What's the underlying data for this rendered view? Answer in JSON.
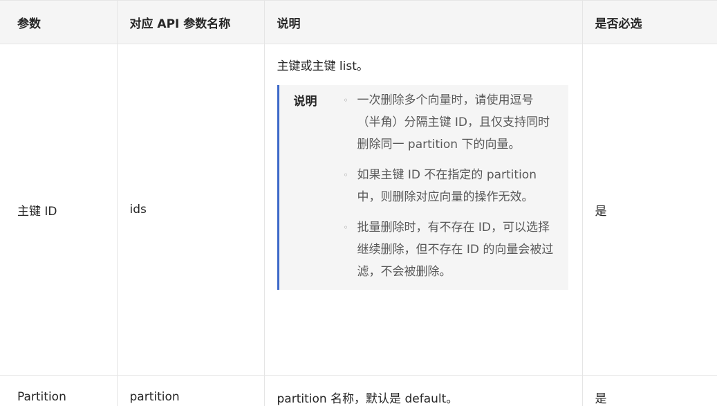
{
  "table": {
    "headers": [
      "参数",
      "对应 API 参数名称",
      "说明",
      "是否必选"
    ],
    "rows": [
      {
        "param": "主键 ID",
        "api_name": "ids",
        "description": "主键或主键 list。",
        "note": {
          "title": "说明",
          "items": [
            "一次删除多个向量时，请使用逗号（半角）分隔主键 ID，且仅支持同时删除同一 partition 下的向量。",
            "如果主键 ID 不在指定的 partition 中，则删除对应向量的操作无效。",
            "批量删除时，有不存在 ID，可以选择继续删除，但不存在 ID 的向量会被过滤，不会被删除。"
          ]
        },
        "required": "是"
      },
      {
        "param": "Partition",
        "api_name": "partition",
        "description": "partition 名称，默认是 default。",
        "required": "是"
      }
    ]
  },
  "colors": {
    "header_bg": "#f5f5f5",
    "note_bg": "#f5f5f5",
    "note_border": "#3c68c8",
    "border": "#e5e5e5"
  }
}
